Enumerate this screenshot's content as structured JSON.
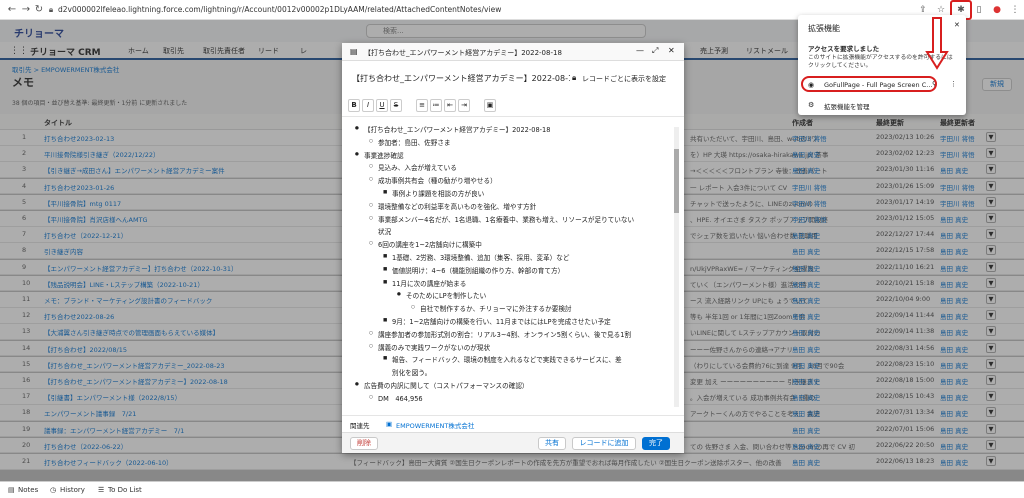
{
  "browser": {
    "url": "d2v000002lfeleao.lightning.force.com/lightning/r/Account/0012v00002p1DLyAAM/related/AttachedContentNotes/view",
    "icons": [
      "back-icon",
      "forward-icon",
      "reload-icon",
      "home-icon"
    ],
    "right_icons": [
      "share-icon",
      "star-icon",
      "puzzle-icon",
      "sidebar-icon",
      "profile-icon",
      "menu-icon"
    ]
  },
  "sf": {
    "logo": "チリョーマ",
    "search_placeholder": "検索...",
    "app_name": "チリョーマ CRM",
    "nav": [
      "ホーム",
      "取引先",
      "取引先責任者",
      "リード",
      "レ"
    ],
    "nav_right": [
      "売上予測",
      "リストメール"
    ],
    "breadcrumb": "取引先 > EMPOWERMENT株式会社",
    "list_title": "メモ",
    "list_meta": "38 個の項目・並び替え基準: 最終更新・1分前 に更新されました",
    "new_button": "新規",
    "col_title": "タイトル",
    "col_author": "作成者",
    "col_modified": "最終更新",
    "col_owner": "最終更新者"
  },
  "rows": [
    {
      "num": "1",
      "title": "打ち合わせ2023-02-13",
      "author": "宇田川 将悟",
      "date": "2023/02/13 10:26",
      "owner": "宇田川 将悟"
    },
    {
      "num": "2",
      "title": "平川接骨院様引き継ぎ（2022/12/22）",
      "author": "島田 真史",
      "date": "2023/02/02 12:23",
      "owner": "宇田川 将悟"
    },
    {
      "num": "3",
      "title": "【引き継ぎ→成田さん】エンパワーメント経営アカデミー案件",
      "author": "島田 真史",
      "date": "2023/01/30 11:16",
      "owner": "島田 真史"
    },
    {
      "num": "4",
      "title": "打ち合わせ2023-01-26",
      "author": "宇田川 将悟",
      "date": "2023/01/26 15:09",
      "owner": "宇田川 将悟"
    },
    {
      "num": "5",
      "title": "【平川接骨院】mtg 0117",
      "author": "宇田川 将悟",
      "date": "2023/01/17 14:19",
      "owner": "宇田川 将悟"
    },
    {
      "num": "6",
      "title": "【平川接骨院】肖沢店様へんAMTG",
      "author": "宇田川 将悟",
      "date": "2023/01/12 15:05",
      "owner": "島田 真史"
    },
    {
      "num": "7",
      "title": "打ち合わせ（2022-12-21）",
      "author": "島田 真史",
      "date": "2022/12/27 17:44",
      "owner": "島田 真史"
    },
    {
      "num": "8",
      "title": "引き継ぎ内容",
      "author": "島田 真史",
      "date": "2022/12/15 17:58",
      "owner": "島田 真史"
    },
    {
      "num": "9",
      "title": "【エンパワーメント経営アカデミー】打ち合わせ（2022-10-31）",
      "author": "島田 真史",
      "date": "2022/11/10 16:21",
      "owner": "島田 真史"
    },
    {
      "num": "10",
      "title": "【残品説明会】LINE・Lステップ構築（2022-10-21）",
      "author": "島田 真史",
      "date": "2022/10/21 15:18",
      "owner": "島田 真史"
    },
    {
      "num": "11",
      "title": "メモ：ブランド・マーケティング設計書のフィードバック",
      "author": "島田 真史",
      "date": "2022/10/04 9:00",
      "owner": "島田 真史"
    },
    {
      "num": "12",
      "title": "打ち合わせ2022-08-26",
      "author": "島田 真史",
      "date": "2022/09/14 11:44",
      "owner": "島田 真史"
    },
    {
      "num": "13",
      "title": "【大浦翼さん引き継ぎ時点での管理画面もらえている媒体】",
      "author": "島田 真史",
      "date": "2022/09/14 11:38",
      "owner": "島田 真史"
    },
    {
      "num": "14",
      "title": "【打ち合わせ】2022/08/15",
      "author": "島田 真史",
      "date": "2022/08/31 14:56",
      "owner": "島田 真史"
    },
    {
      "num": "15",
      "title": "【打ち合わせ_エンパワーメント経営アカデミー_2022-08-23",
      "author": "島田 真史",
      "date": "2022/08/23 15:10",
      "owner": "島田 真史"
    },
    {
      "num": "16",
      "title": "【打ち合わせ_エンパワーメント経営アカデミー】2022-08-18",
      "author": "島田 真史",
      "date": "2022/08/18 15:00",
      "owner": "島田 真史"
    },
    {
      "num": "17",
      "title": "【引継書】エンパワーメント様（2022/8/15）",
      "author": "島田 真史",
      "date": "2022/08/15 10:43",
      "owner": "島田 真史"
    },
    {
      "num": "18",
      "title": "エンパワーメント議事録　7/21",
      "author": "島田 真史",
      "date": "2022/07/31 13:34",
      "owner": "島田 真史"
    },
    {
      "num": "19",
      "title": "議事録：エンパワーメント経営アカデミー　7/1",
      "author": "島田 真史",
      "date": "2022/07/01 15:06",
      "owner": "島田 真史"
    },
    {
      "num": "20",
      "title": "打ち合わせ（2022-06-22）",
      "author": "島田 真史",
      "date": "2022/06/22 20:50",
      "owner": "島田 真史"
    },
    {
      "num": "21",
      "title": "打ち合わせフィードバック（2022-06-10）",
      "author": "島田 真史",
      "date": "2022/06/13 18:23",
      "owner": "島田 真史"
    }
  ],
  "modal": {
    "window_title": "【打ち合わせ_エンパワーメント経営アカデミー】2022-08-18",
    "subject": "【打ち合わせ_エンパワーメント経営アカデミー】2022-08-18",
    "record_view": "レコードごとに表示を設定",
    "toolbar": [
      "B",
      "I",
      "U",
      "S",
      "≡",
      "≔",
      "⇤",
      "⇥",
      "▣"
    ],
    "lines": [
      {
        "level": 0,
        "text": "【打ち合わせ_エンパワーメント経営アカデミー】2022-08-18"
      },
      {
        "level": 1,
        "text": "参加者：島田、佐野さま"
      },
      {
        "level": 0,
        "text": "事業進捗確認"
      },
      {
        "level": 1,
        "text": "見込み、入会が増えている"
      },
      {
        "level": 1,
        "text": "成功事例共有会（種の勧がり増やせる）"
      },
      {
        "level": 2,
        "text": "事例より課題を相談の方が良い"
      },
      {
        "level": 1,
        "text": "環境整備などの利益率を高いものを強化、増やす方針"
      },
      {
        "level": 1,
        "text": "事業部メンバー4名だが、1名退職、1名療養中、業務も増え、リソースが足りていない"
      },
      {
        "level": 1,
        "text": "状況",
        "nobullet": true
      },
      {
        "level": 1,
        "text": "6回の講座を1~2店舗向けに構築中"
      },
      {
        "level": 2,
        "text": "1基礎、2労務、3環境整備、追加（集客、採用、変革）など"
      },
      {
        "level": 2,
        "text": "価値説明け：4~6（機能別組織の作り方、幹部の育て方）"
      },
      {
        "level": 2,
        "text": "11月に次の講座が始まる"
      },
      {
        "level": 3,
        "text": "そのためにLPを制作したい"
      },
      {
        "level": 4,
        "text": "自社で制作するか、チリョーマに外注するか要検討"
      },
      {
        "level": 2,
        "text": "9月：1~2店舗向けの構築を行い、11月まではにはLPを完成させたい予定"
      },
      {
        "level": 1,
        "text": "講座参加者の参加形式別の割合：リアル3~4割、オンライン5割くらい、後で見る1割"
      },
      {
        "level": 1,
        "text": "講義のみで実践ワークがないのが現状"
      },
      {
        "level": 2,
        "text": "報告、フィードバック、環境の制度を入れるなどで実践できるサービスに、差"
      },
      {
        "level": 2,
        "text": "別化を図う。",
        "nobullet": true
      },
      {
        "level": 0,
        "text": "広告費の内訳に関して（コストパフォーマンスの確認）"
      },
      {
        "level": 1,
        "text": "DM　464,956"
      }
    ],
    "related_label": "関連先",
    "related_value": "EMPOWERMENT株式会社",
    "delete": "削除",
    "share": "共有",
    "add_record": "レコードに追加",
    "done": "完了"
  },
  "bg_snippets": [
    "共有いただいて、宇田川、島田、webの3ワ",
    "を）HP 大瑛 https://osaka-hirakawa.jp/ 茶事",
    "→＜＜＜＜＜フロントプラン 寺後：改善パート",
    "一 レポート 入会3件について CV",
    "チャットで送ったように、LINEのzoomの",
    "、HPE. オイエさま タスク ポップアップ開設終",
    "でシェア数を追いたい 悩い合わせ数 就職用",
    "",
    "n/UkjVPRaxWE= / マーケティング金曜設",
    "ていく（エンパワーメント様）進活の特",
    "ース 流入経路リンク UPにも ょうていて",
    "等も 半年1回 or 1年間に1回Zoomで会",
    "いLINEに関して Lステップアカウント取付の",
    "ーーー佐野さんからの連絡→アナリ",
    "（わりにしている会費約76に到達 9月、10月で90会",
    "変更 加え ーーーーーーーーーー 引き継ぎで",
    "。入会が増えている 成功事例共有会（種の",
    "アークトーくんの方でやることを考え、会読",
    "",
    "ての 佐野さま 入金、問い合わせ等＞zoomの再で CV 初",
    "【フィードバック】島田ー大資質 ②国生日クーポンレポートの作成を先方が重望でおれば毎月作成したい ②国生日クーポン送除ポスター、他の改善"
  ],
  "extensions": {
    "title": "拡張機能",
    "access_heading": "アクセスを要求しました",
    "access_desc": "このサイトに拡張機能がアクセスするのを許可するにはクリックしてください。",
    "item": "GoFullPage - Full Page Screen C...",
    "manage": "拡張機能を管理"
  },
  "footer": {
    "notes": "Notes",
    "history": "History",
    "todo": "To Do List"
  },
  "colors": {
    "sf_blue": "#0070d2",
    "nav_underline": "#1b5297",
    "highlight_red": "#d81f1f"
  }
}
